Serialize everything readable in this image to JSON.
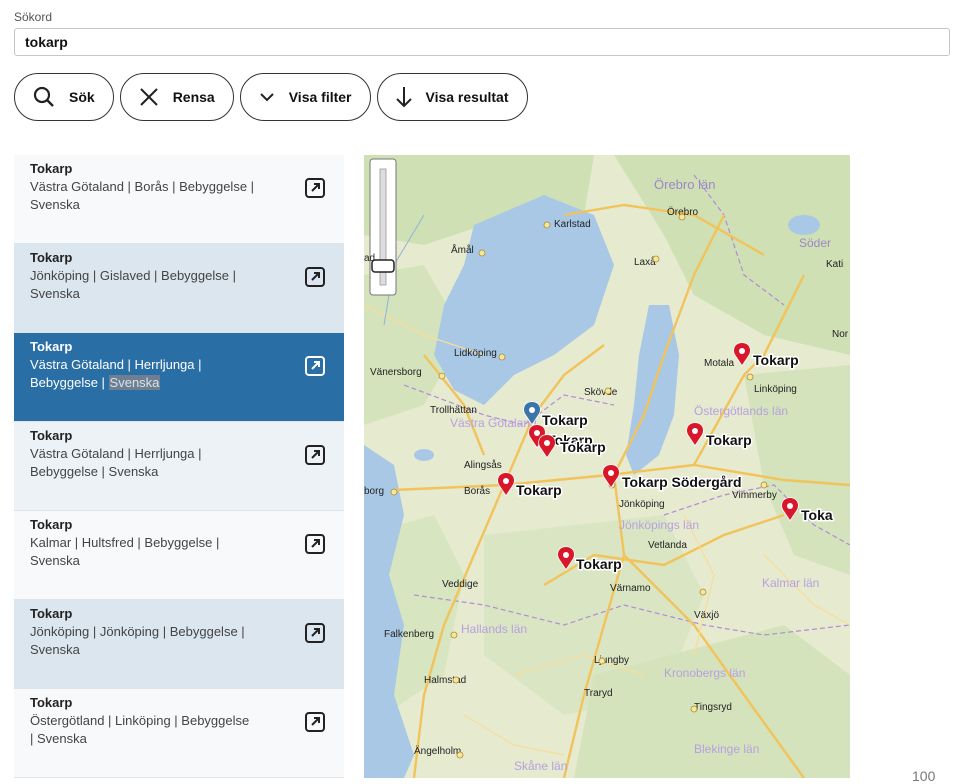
{
  "search": {
    "label": "Sökord",
    "value": "tokarp"
  },
  "toolbar": {
    "search_label": "Sök",
    "clear_label": "Rensa",
    "filter_label": "Visa filter",
    "results_label": "Visa resultat"
  },
  "results": [
    {
      "title": "Tokarp",
      "desc_lines": [
        "Västra Götaland | Borås | Bebyggelse |",
        "Svenska"
      ]
    },
    {
      "title": "Tokarp",
      "desc_lines": [
        "Jönköping | Gislaved | Bebyggelse |",
        "Svenska"
      ]
    },
    {
      "title": "Tokarp",
      "desc_lines": [
        "Västra Götaland | Herrljunga |",
        "Bebyggelse | "
      ],
      "highlight": "Svenska"
    },
    {
      "title": "Tokarp",
      "desc_lines": [
        "Västra Götaland | Herrljunga |",
        "Bebyggelse | Svenska"
      ]
    },
    {
      "title": "Tokarp",
      "desc_lines": [
        "Kalmar | Hultsfred | Bebyggelse |",
        "Svenska"
      ]
    },
    {
      "title": "Tokarp",
      "desc_lines": [
        "Jönköping | Jönköping | Bebyggelse |",
        "Svenska"
      ]
    },
    {
      "title": "Tokarp",
      "desc_lines": [
        "Östergötland | Linköping | Bebyggelse",
        "| Svenska"
      ]
    }
  ],
  "map": {
    "places": [
      "Karlstad",
      "Örebro",
      "Örebro län",
      "Åmål",
      "Laxå",
      "Kati",
      "Söder",
      "Nor",
      "Lidköping",
      "Vänersborg",
      "Skövde",
      "Motala",
      "Linköping",
      "Trollhättan",
      "Västra Götaland",
      "Östergötlands län",
      "Alingsås",
      "Borås",
      "Jönköping",
      "Vimmerby",
      "Jönköpings län",
      "Vetlanda",
      "Veddige",
      "Värnamo",
      "Kalmar län",
      "Falkenberg",
      "Hallands län",
      "Växjö",
      "Ljungby",
      "Halmstad",
      "Kronobergs län",
      "Traryd",
      "Tingsryd",
      "Ängelholm",
      "Skåne län",
      "Blekinge län",
      "borg",
      "ad"
    ],
    "markers": [
      "Tokarp",
      "Tokarp",
      "Tokarp",
      "Tokarp",
      "Tokarp",
      "Tokarp",
      "Tokarp Södergård",
      "Toka",
      "Tokarp"
    ],
    "colors": {
      "marker": "#d9172b",
      "marker_selected": "#3b74a7",
      "water": "#a9c8e6",
      "road": "#f2c35a"
    }
  },
  "pagination": {
    "count": "100"
  }
}
